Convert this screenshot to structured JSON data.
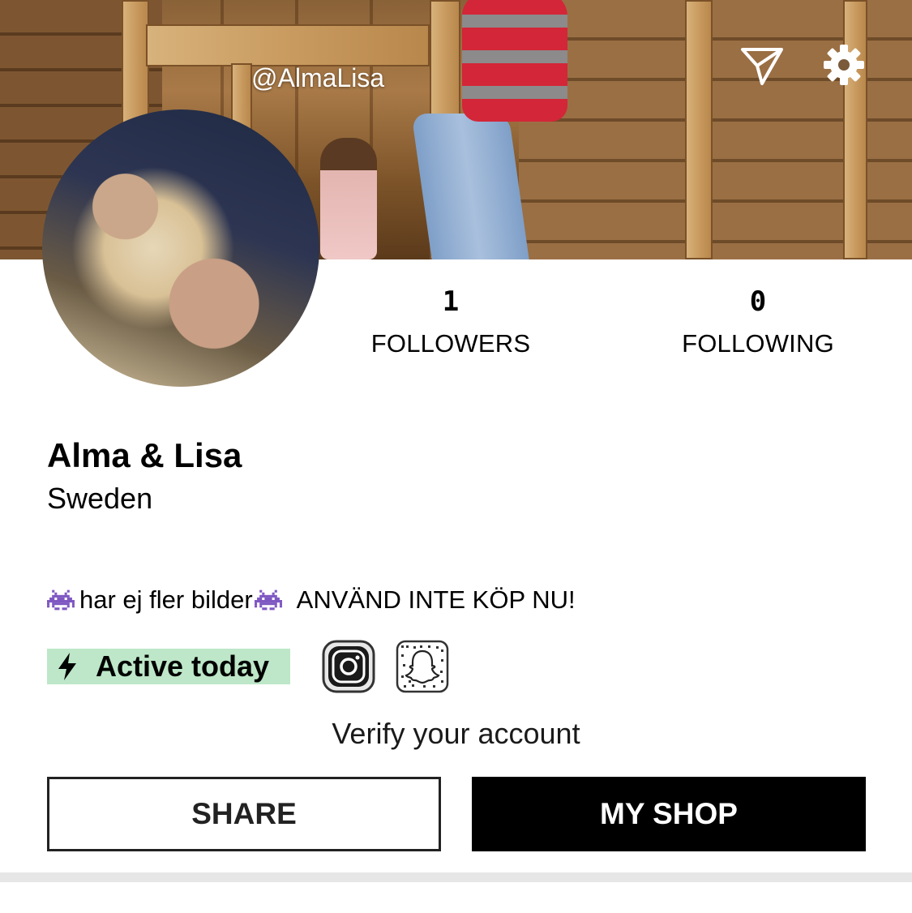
{
  "profile": {
    "handle": "@AlmaLisa",
    "display_name": "Alma & Lisa",
    "location": "Sweden",
    "bio_text": "har ej fler bilder",
    "bio_note": "ANVÄND INTE KÖP NU!",
    "bio_emoji": "space-invader-icon"
  },
  "stats": {
    "followers_count": "1",
    "followers_label": "FOLLOWERS",
    "following_count": "0",
    "following_label": "FOLLOWING"
  },
  "status": {
    "active_label": "Active today",
    "active_color": "#bde7c8"
  },
  "links": {
    "verify_label": "Verify your account"
  },
  "buttons": {
    "share_label": "SHARE",
    "shop_label": "MY SHOP"
  },
  "icons": {
    "send": "send-icon",
    "settings": "gear-icon",
    "instagram": "instagram-icon",
    "snapchat": "snapchat-icon",
    "active": "lightning-bolt-icon"
  },
  "colors": {
    "primary_button_bg": "#000000",
    "active_badge_bg": "#bde7c8",
    "divider": "#e6e6e6"
  }
}
